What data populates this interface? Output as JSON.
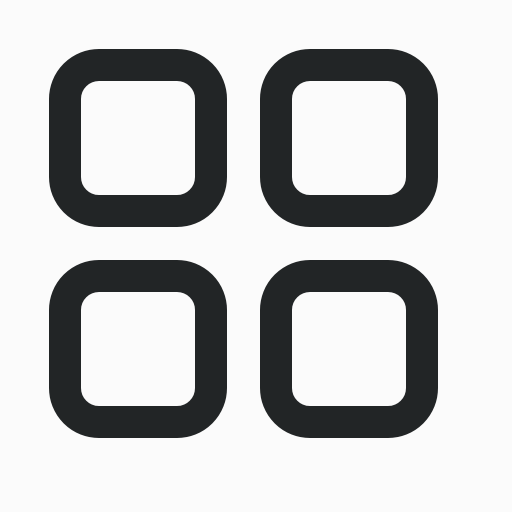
{
  "icon": {
    "name": "grid-view-icon",
    "stroke_color": "#222526",
    "background_color": "#fbfbfb"
  }
}
